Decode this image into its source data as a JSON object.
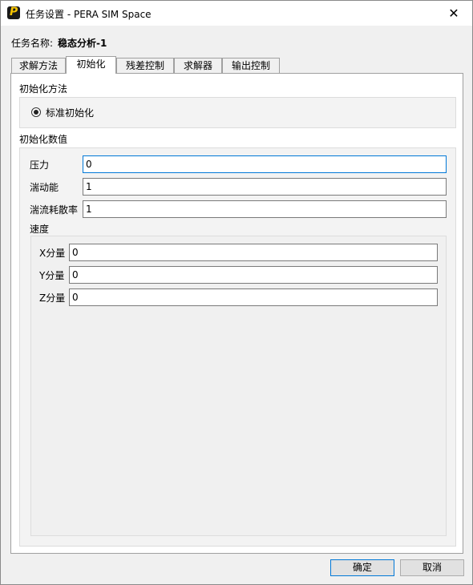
{
  "window": {
    "title": "任务设置 - PERA SIM Space",
    "close_glyph": "✕"
  },
  "task": {
    "label": "任务名称:",
    "value": "稳态分析-1"
  },
  "tabs": [
    {
      "label": "求解方法"
    },
    {
      "label": "初始化"
    },
    {
      "label": "残差控制"
    },
    {
      "label": "求解器"
    },
    {
      "label": "输出控制"
    }
  ],
  "init_method": {
    "section": "初始化方法",
    "option": "标准初始化"
  },
  "init_values": {
    "section": "初始化数值",
    "pressure": {
      "label": "压力",
      "value": "0"
    },
    "tke": {
      "label": "湍动能",
      "value": "1"
    },
    "dissipation": {
      "label": "湍流耗散率",
      "value": "1"
    },
    "velocity": {
      "label": "速度",
      "x": {
        "label": "X分量",
        "value": "0"
      },
      "y": {
        "label": "Y分量",
        "value": "0"
      },
      "z": {
        "label": "Z分量",
        "value": "0"
      }
    }
  },
  "buttons": {
    "ok": "确定",
    "cancel": "取消"
  },
  "colors": {
    "focus": "#0078d7",
    "app_icon_bg": "#1a1a1a",
    "app_icon_fg": "#f5c400"
  },
  "icons": {
    "app": "pera-logo-icon",
    "close": "close-icon"
  }
}
